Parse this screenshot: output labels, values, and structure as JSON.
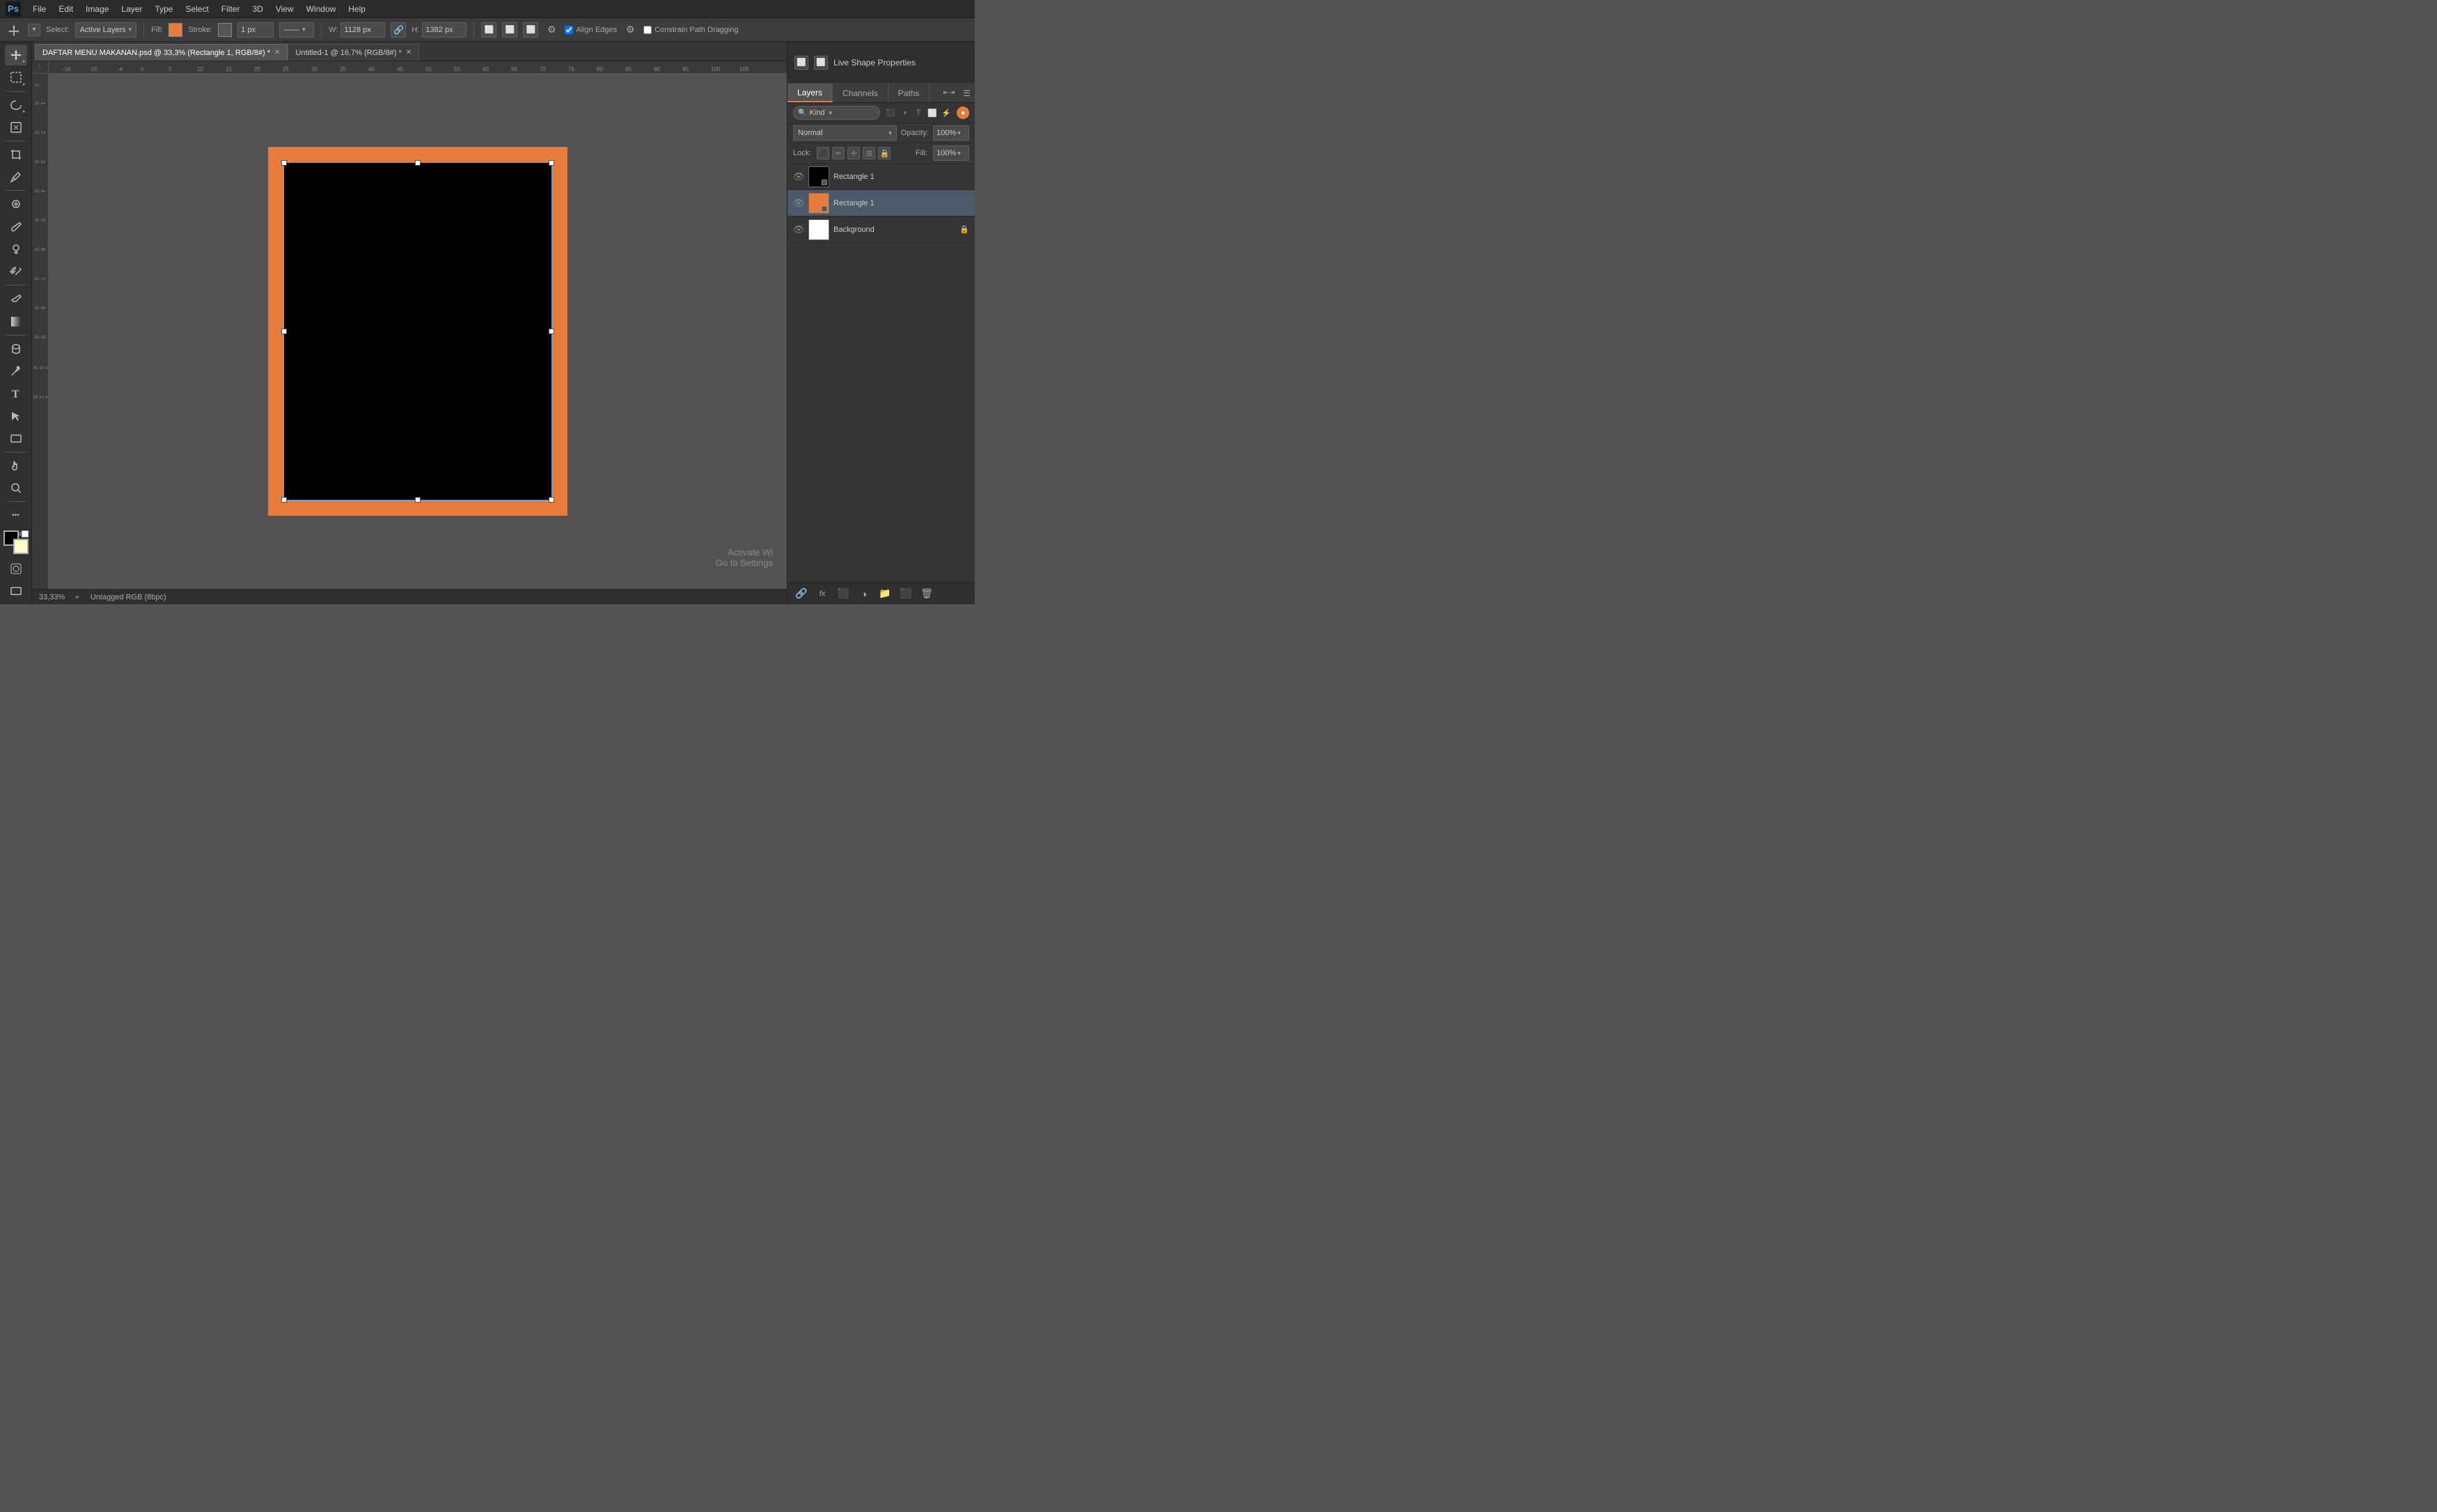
{
  "menubar": {
    "logo": "Ps",
    "items": [
      "File",
      "Edit",
      "Image",
      "Layer",
      "Type",
      "Select",
      "Filter",
      "3D",
      "View",
      "Window",
      "Help"
    ]
  },
  "optionsbar": {
    "tool_label": "Select:",
    "select_value": "Active Layers",
    "fill_label": "Fill:",
    "fill_color": "#e87c3e",
    "stroke_label": "Stroke:",
    "stroke_value": "1 px",
    "w_label": "W:",
    "w_value": "1128 px",
    "h_label": "H:",
    "h_value": "1382 px",
    "align_edges_label": "Align Edges",
    "constrain_label": "Constrain Path Dragging"
  },
  "tabs": [
    {
      "label": "DAFTAR MENU MAKANAN.psd @ 33,3% (Rectangle 1, RGB/8#) *",
      "active": true
    },
    {
      "label": "Untitled-1 @ 16,7% (RGB/8#) *",
      "active": false
    }
  ],
  "properties_panel": {
    "title": "Properties",
    "subtitle": "Live Shape Properties"
  },
  "layers_panel": {
    "tabs": [
      "Layers",
      "Channels",
      "Paths"
    ],
    "search_placeholder": "Kind",
    "mode_value": "Normal",
    "opacity_label": "Opacity:",
    "opacity_value": "100%",
    "lock_label": "Lock:",
    "fill_label": "Fill:",
    "fill_value": "100%",
    "layers": [
      {
        "name": "Rectangle 1",
        "visible": true,
        "active": false,
        "locked": false,
        "thumb_type": "black"
      },
      {
        "name": "Rectangle 1",
        "visible": true,
        "active": true,
        "locked": false,
        "thumb_type": "orange"
      },
      {
        "name": "Background",
        "visible": true,
        "active": false,
        "locked": true,
        "thumb_type": "white"
      }
    ]
  },
  "statusbar": {
    "zoom": "33,33%",
    "info": "Untagged RGB (8bpc)"
  },
  "watermark": {
    "line1": "Activate Wi",
    "line2": "Go to Settings"
  }
}
